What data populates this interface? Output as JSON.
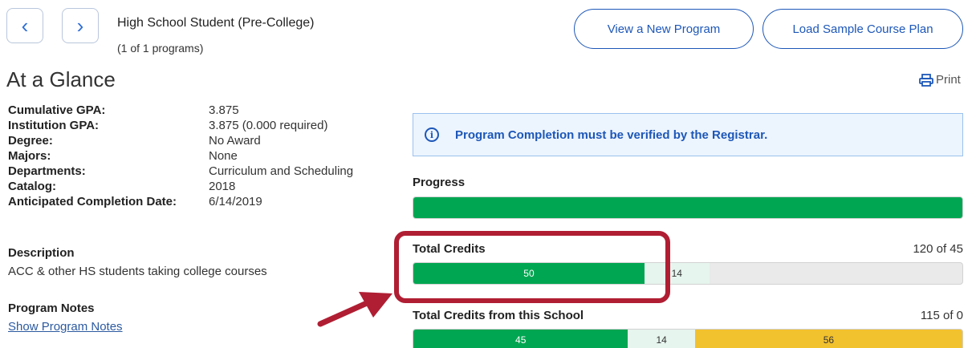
{
  "header": {
    "prev_glyph": "‹",
    "next_glyph": "›",
    "program_title": "High School Student (Pre-College)",
    "program_count": "(1 of 1 programs)",
    "view_button": "View a New Program",
    "load_button": "Load Sample Course Plan"
  },
  "glance": {
    "title": "At a Glance",
    "print_label": "Print"
  },
  "details": [
    {
      "label": "Cumulative GPA:",
      "value": "3.875"
    },
    {
      "label": "Institution GPA:",
      "value": "3.875 (0.000 required)"
    },
    {
      "label": "Degree:",
      "value": "No Award"
    },
    {
      "label": "Majors:",
      "value": "None"
    },
    {
      "label": "Departments:",
      "value": "Curriculum and Scheduling"
    },
    {
      "label": "Catalog:",
      "value": "2018"
    },
    {
      "label": "Anticipated Completion Date:",
      "value": "6/14/2019"
    }
  ],
  "description": {
    "heading": "Description",
    "text": "ACC & other HS students taking college courses"
  },
  "notes": {
    "heading": "Program Notes",
    "link": "Show Program Notes"
  },
  "alert": {
    "icon": "i",
    "text": "Program Completion must be verified by the Registrar."
  },
  "progress": {
    "label": "Progress",
    "completed_fraction": 1.0
  },
  "total_credits": {
    "label": "Total Credits",
    "summary": "120 of 45",
    "segments": [
      {
        "label": "50",
        "fraction": 0.421,
        "kind": "green"
      },
      {
        "label": "14",
        "fraction": 0.118,
        "kind": "light"
      }
    ]
  },
  "school_credits": {
    "label": "Total Credits from this School",
    "summary": "115 of 0",
    "segments": [
      {
        "label": "45",
        "fraction": 0.391,
        "kind": "green"
      },
      {
        "label": "14",
        "fraction": 0.122,
        "kind": "light"
      },
      {
        "label": "56",
        "fraction": 0.487,
        "kind": "yellow"
      }
    ]
  },
  "colors": {
    "accent_blue": "#1d57b8",
    "progress_green": "#00a651",
    "planned_yellow": "#f2c12e",
    "annotation_red": "#b01e33"
  }
}
